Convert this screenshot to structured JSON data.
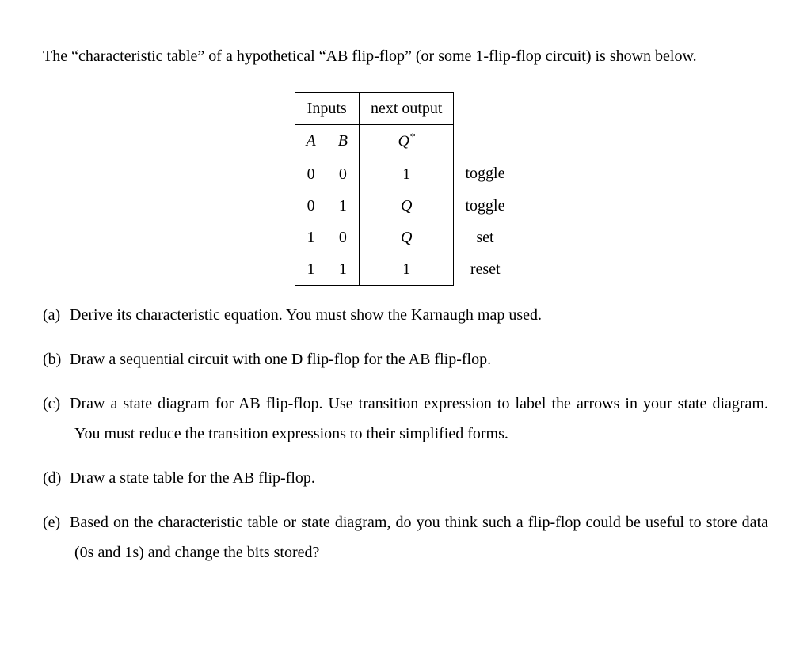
{
  "intro": "The “characteristic table” of a hypothetical “AB flip-flop” (or some 1-flip-flop circuit) is shown below.",
  "table": {
    "header": {
      "inputs": "Inputs",
      "next_output": "next output"
    },
    "sub": {
      "A": "A",
      "B": "B",
      "Qstar": "Q*"
    },
    "rows": [
      {
        "A": "0",
        "B": "0",
        "Q": "1",
        "note": "toggle"
      },
      {
        "A": "0",
        "B": "1",
        "Q": "Q",
        "note": "toggle"
      },
      {
        "A": "1",
        "B": "0",
        "Q": "Q",
        "note": "set"
      },
      {
        "A": "1",
        "B": "1",
        "Q": "1",
        "note": "reset"
      }
    ]
  },
  "questions": {
    "a": {
      "label": "(a)",
      "text": "Derive its characteristic equation. You must show the Karnaugh map used."
    },
    "b": {
      "label": "(b)",
      "text": "Draw a sequential circuit with one D flip-flop for the AB flip-flop."
    },
    "c": {
      "label": "(c)",
      "text": "Draw a state diagram for AB flip-flop.  Use transition expression to label the arrows in your state diagram. You must reduce the transition expressions to their simplified forms."
    },
    "d": {
      "label": "(d)",
      "text": "Draw a state table for the AB flip-flop."
    },
    "e": {
      "label": "(e)",
      "text": "Based on the characteristic table or state diagram, do you think such a flip-flop could be useful to store data (0s and 1s) and change the bits stored?"
    }
  }
}
